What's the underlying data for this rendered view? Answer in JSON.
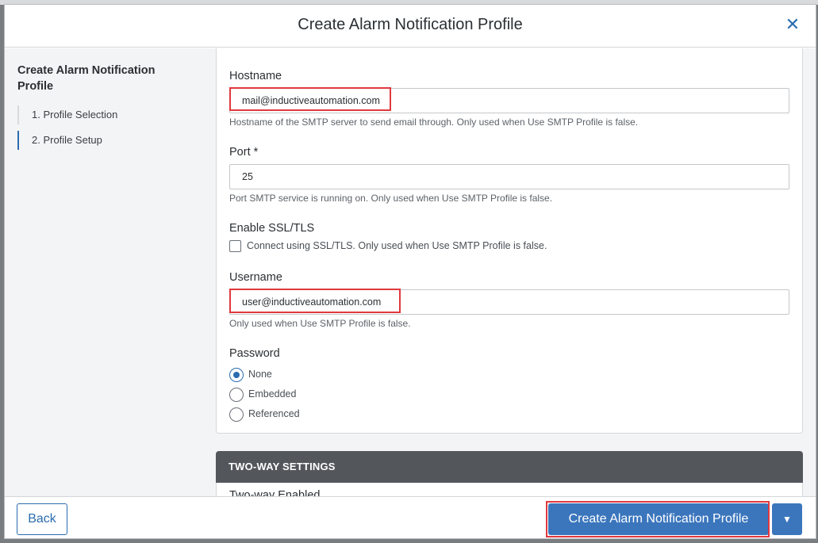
{
  "dialog": {
    "title": "Create Alarm Notification Profile",
    "close_icon": "close-icon"
  },
  "sidebar": {
    "title": "Create Alarm Notification Profile",
    "steps": [
      {
        "label": "1. Profile Selection",
        "active": false
      },
      {
        "label": "2. Profile Setup",
        "active": true
      }
    ]
  },
  "form": {
    "hostname": {
      "label": "Hostname",
      "value": "mail@inductiveautomation.com",
      "hint": "Hostname of the SMTP server to send email through. Only used when Use SMTP Profile is false."
    },
    "port": {
      "label": "Port *",
      "value": "25",
      "hint": "Port SMTP service is running on. Only used when Use SMTP Profile is false."
    },
    "ssl": {
      "label": "Enable SSL/TLS",
      "checkbox_label": "Connect using SSL/TLS. Only used when Use SMTP Profile is false.",
      "checked": false
    },
    "username": {
      "label": "Username",
      "value": "user@inductiveautomation.com",
      "hint": "Only used when Use SMTP Profile is false."
    },
    "password": {
      "label": "Password",
      "options": [
        {
          "label": "None",
          "selected": true
        },
        {
          "label": "Embedded",
          "selected": false
        },
        {
          "label": "Referenced",
          "selected": false
        }
      ]
    }
  },
  "two_way": {
    "title": "TWO-WAY SETTINGS",
    "peek_label": "Two-way Enabled"
  },
  "footer": {
    "back_label": "Back",
    "create_label": "Create Alarm Notification Profile",
    "dropdown_icon": "caret-down-icon"
  },
  "colors": {
    "accent": "#3b76bd",
    "highlight": "#e0393e",
    "section_bar": "#53575c"
  }
}
